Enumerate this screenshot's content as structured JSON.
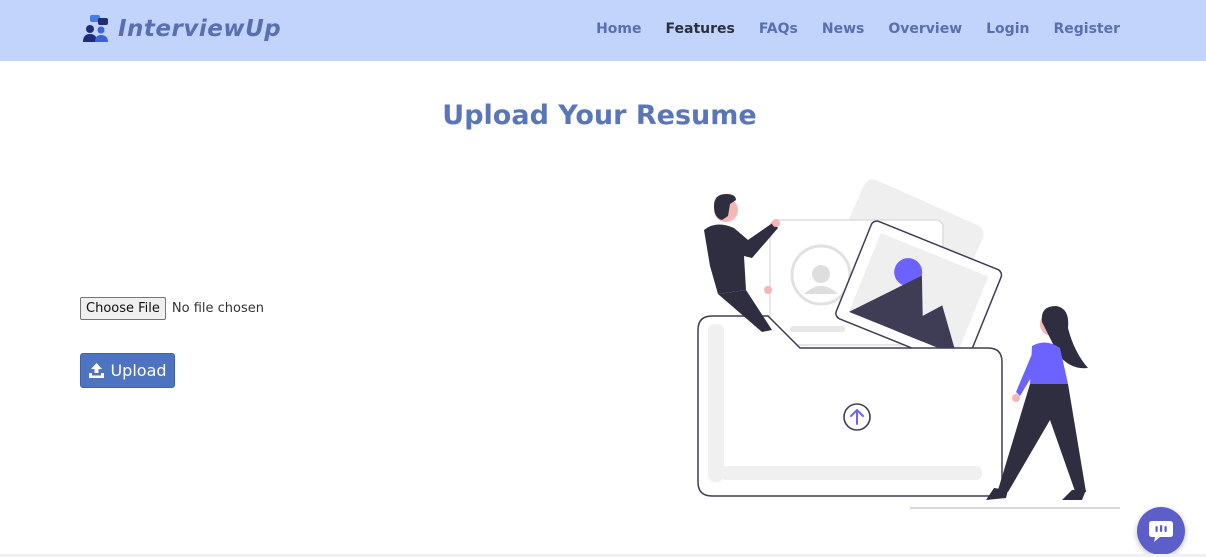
{
  "brand": {
    "name": "InterviewUp",
    "icon": "people-chat-icon"
  },
  "nav": {
    "items": [
      {
        "label": "Home",
        "active": false
      },
      {
        "label": "Features",
        "active": true
      },
      {
        "label": "FAQs",
        "active": false
      },
      {
        "label": "News",
        "active": false
      },
      {
        "label": "Overview",
        "active": false
      },
      {
        "label": "Login",
        "active": false
      },
      {
        "label": "Register",
        "active": false
      }
    ]
  },
  "main": {
    "title": "Upload Your Resume",
    "file_input": {
      "button_label": "Choose File",
      "status": "No file chosen"
    },
    "upload_button": {
      "label": "Upload",
      "icon": "upload-icon"
    },
    "illustration": "upload-folder-illustration"
  },
  "chat": {
    "icon": "chat-bubble-icon"
  },
  "colors": {
    "navbar_bg": "#c2d4fb",
    "brand": "#5a6fb0",
    "nav_active": "#2b2f3e",
    "title": "#5a76b8",
    "button": "#4e73c0",
    "accent_purple": "#6c63ff",
    "chat_fab": "#5b5fc7"
  }
}
